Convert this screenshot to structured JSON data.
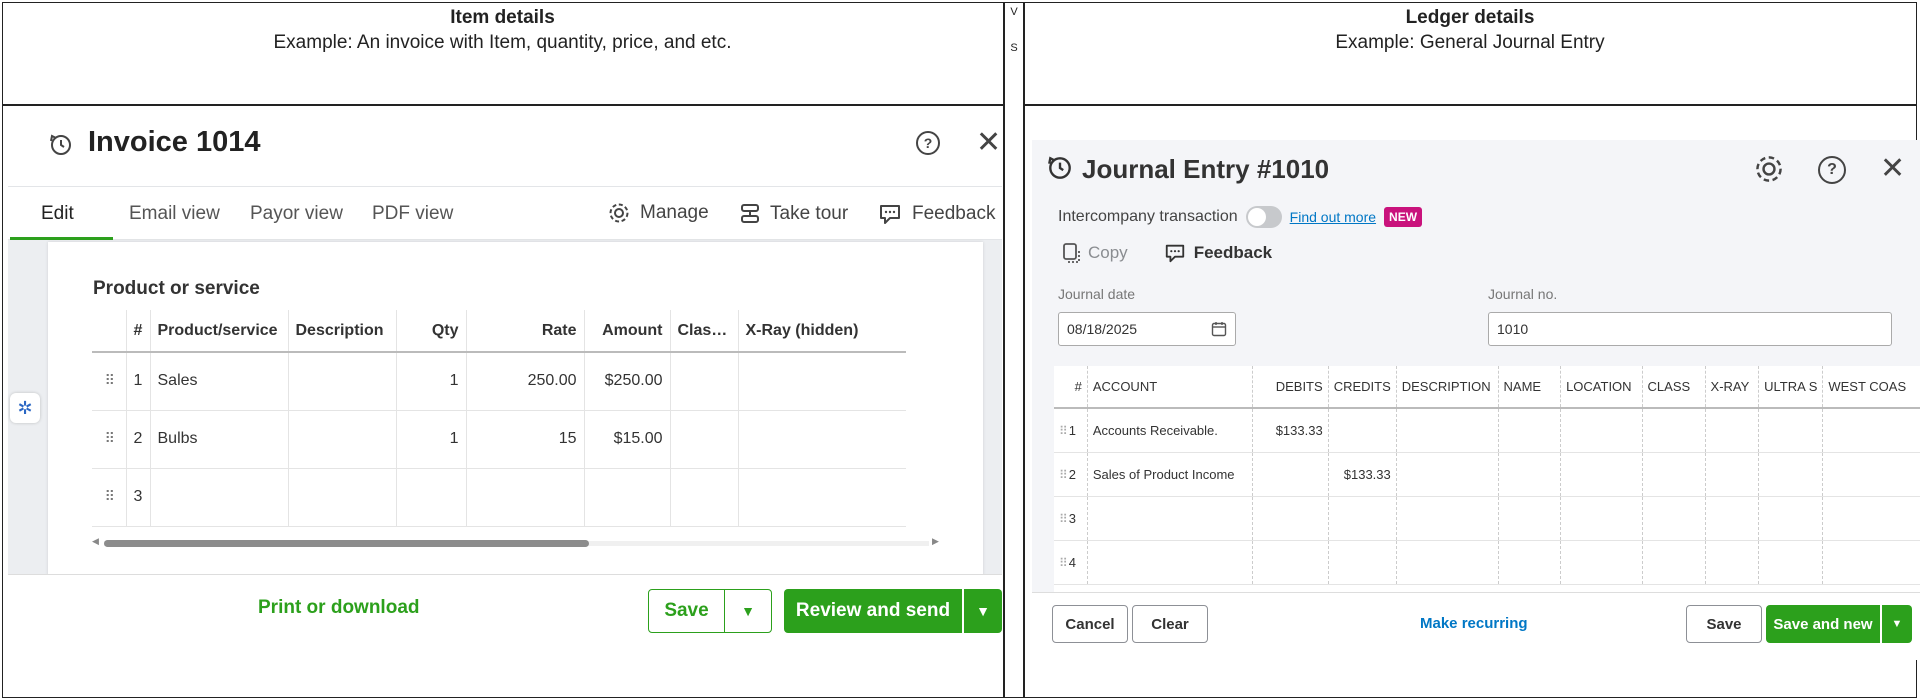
{
  "left_header": {
    "title": "Item details",
    "subtitle": "Example: An invoice with Item, quantity, price, and etc."
  },
  "divider": {
    "v": "V",
    "s": "S"
  },
  "right_header": {
    "title": "Ledger details",
    "subtitle": "Example: General Journal Entry"
  },
  "invoice": {
    "title": "Invoice 1014",
    "tabs": [
      "Edit",
      "Email view",
      "Payor view",
      "PDF view"
    ],
    "tools": {
      "manage": "Manage",
      "tour": "Take tour",
      "feedback": "Feedback"
    },
    "section_title": "Product or service",
    "columns": [
      "#",
      "Product/service",
      "Description",
      "Qty",
      "Rate",
      "Amount",
      "Clas…",
      "X-Ray (hidden)"
    ],
    "rows": [
      {
        "num": "1",
        "product": "Sales",
        "description": "",
        "qty": "1",
        "rate": "250.00",
        "amount": "$250.00"
      },
      {
        "num": "2",
        "product": "Bulbs",
        "description": "",
        "qty": "1",
        "rate": "15",
        "amount": "$15.00"
      },
      {
        "num": "3",
        "product": "",
        "description": "",
        "qty": "",
        "rate": "",
        "amount": ""
      }
    ],
    "footer": {
      "print": "Print or download",
      "save": "Save",
      "review": "Review and send"
    }
  },
  "journal": {
    "title": "Journal Entry #1010",
    "intercompany": "Intercompany transaction",
    "find_out": "Find out more",
    "new_badge": "NEW",
    "copy": "Copy",
    "feedback": "Feedback",
    "date_label": "Journal date",
    "date_value": "08/18/2025",
    "no_label": "Journal no.",
    "no_value": "1010",
    "columns": [
      "#",
      "ACCOUNT",
      "DEBITS",
      "CREDITS",
      "DESCRIPTION",
      "NAME",
      "LOCATION",
      "CLASS",
      "X-RAY",
      "ULTRA S",
      "WEST COAS"
    ],
    "rows": [
      {
        "num": "1",
        "account": "Accounts Receivable.",
        "debits": "$133.33",
        "credits": ""
      },
      {
        "num": "2",
        "account": "Sales of Product Income",
        "debits": "",
        "credits": "$133.33"
      },
      {
        "num": "3",
        "account": "",
        "debits": "",
        "credits": ""
      },
      {
        "num": "4",
        "account": "",
        "debits": "",
        "credits": ""
      }
    ],
    "footer": {
      "cancel": "Cancel",
      "clear": "Clear",
      "recurring": "Make recurring",
      "save": "Save",
      "save_new": "Save and new"
    }
  }
}
